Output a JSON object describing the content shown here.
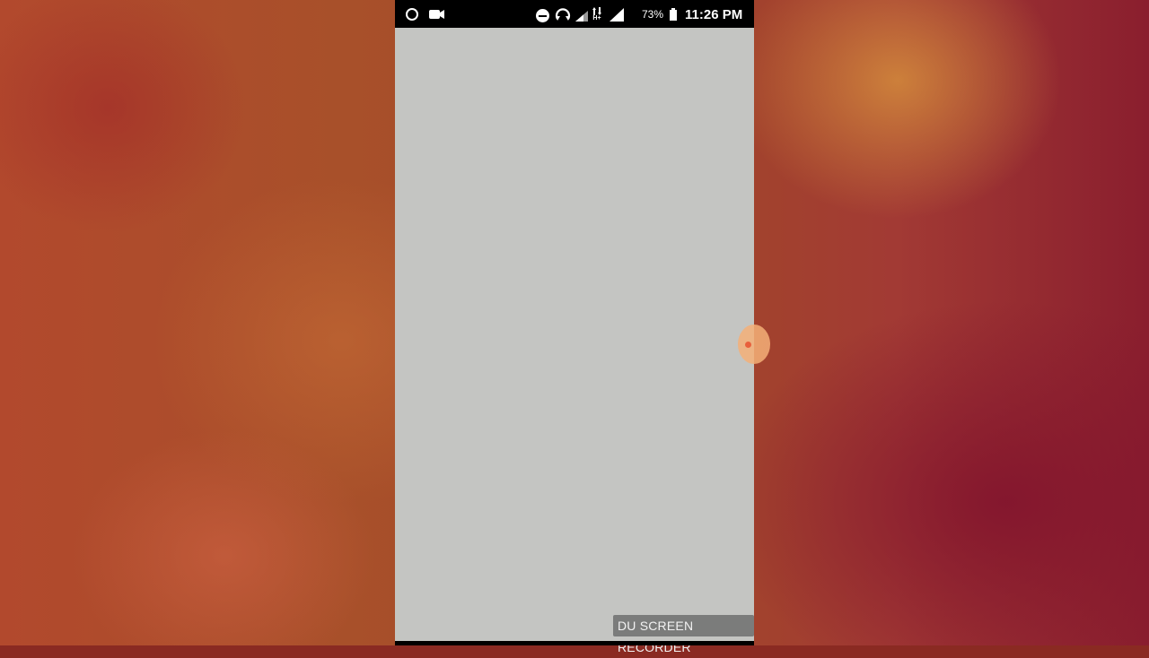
{
  "status_bar": {
    "battery_percent": "73%",
    "time": "11:26 PM",
    "network_type": "H+",
    "icons": [
      "record-icon",
      "video-camera-icon",
      "do-not-disturb-icon",
      "sync-icon",
      "signal-icon",
      "data-arrows-icon",
      "signal-icon",
      "battery-icon"
    ]
  },
  "watermark": {
    "text": "DU SCREEN RECORDER"
  },
  "floating_button": {
    "icon": "screen-recorder-bubble-icon",
    "color": "#e8603c"
  },
  "colors": {
    "screen_background": "#c4c5c2",
    "status_bar": "#000000"
  }
}
